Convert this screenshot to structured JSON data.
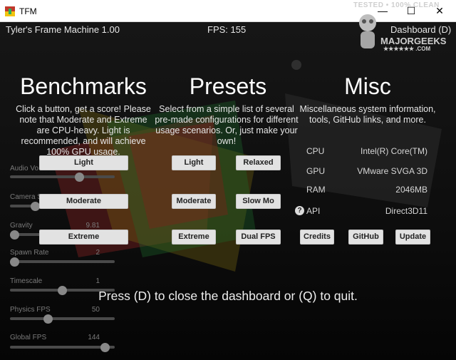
{
  "window": {
    "title": "TFM",
    "minimize_glyph": "—",
    "maximize_glyph": "☐",
    "close_glyph": "✕"
  },
  "hud": {
    "app_version": "Tyler's Frame Machine 1.00",
    "fps": "FPS: 155",
    "dashboard": "Dashboard (D)"
  },
  "watermark": {
    "line1": "TESTED • 100% CLEAN",
    "line2": "MAJORGEEKS",
    "line3": "★★★★★★ .COM"
  },
  "sections": {
    "benchmarks": {
      "title": "Benchmarks",
      "desc": "Click a button, get a score! Please note that Moderate and Extreme are CPU-heavy. Light is recommended, and will achieve 100% GPU usage."
    },
    "presets": {
      "title": "Presets",
      "desc": "Select from a simple list of several pre-made configurations for different usage scenarios. Or, just make your own!"
    },
    "misc": {
      "title": "Misc",
      "desc": "Miscellaneous system information, tools, GitHub links, and more."
    }
  },
  "buttons": {
    "bench_light": "Light",
    "bench_moderate": "Moderate",
    "bench_extreme": "Extreme",
    "preset_light": "Light",
    "preset_relaxed": "Relaxed",
    "preset_moderate": "Moderate",
    "preset_slowmo": "Slow Mo",
    "preset_extreme": "Extreme",
    "preset_dualfps": "Dual FPS",
    "credits": "Credits",
    "github": "GitHub",
    "update": "Update"
  },
  "sliders": [
    {
      "label": "Audio Vo",
      "value": "",
      "level": 0.68
    },
    {
      "label": "Camera S",
      "value": "",
      "level": 0.22
    },
    {
      "label": "Gravity",
      "value": "9.81",
      "level": 0.0
    },
    {
      "label": "Spawn Rate",
      "value": "2",
      "level": 0.0
    },
    {
      "label": "Timescale",
      "value": "1",
      "level": 0.5
    },
    {
      "label": "Physics FPS",
      "value": "50",
      "level": 0.35
    },
    {
      "label": "Global FPS",
      "value": "144",
      "level": 0.95
    }
  ],
  "system_info": {
    "cpu_label": "CPU",
    "cpu_value": "Intel(R) Core(TM)",
    "gpu_label": "GPU",
    "gpu_value": "VMware SVGA 3D",
    "ram_label": "RAM",
    "ram_value": "2046MB",
    "api_label": "API",
    "api_value": "Direct3D11",
    "help_glyph": "?"
  },
  "footer": "Press (D) to close the dashboard or (Q) to quit."
}
